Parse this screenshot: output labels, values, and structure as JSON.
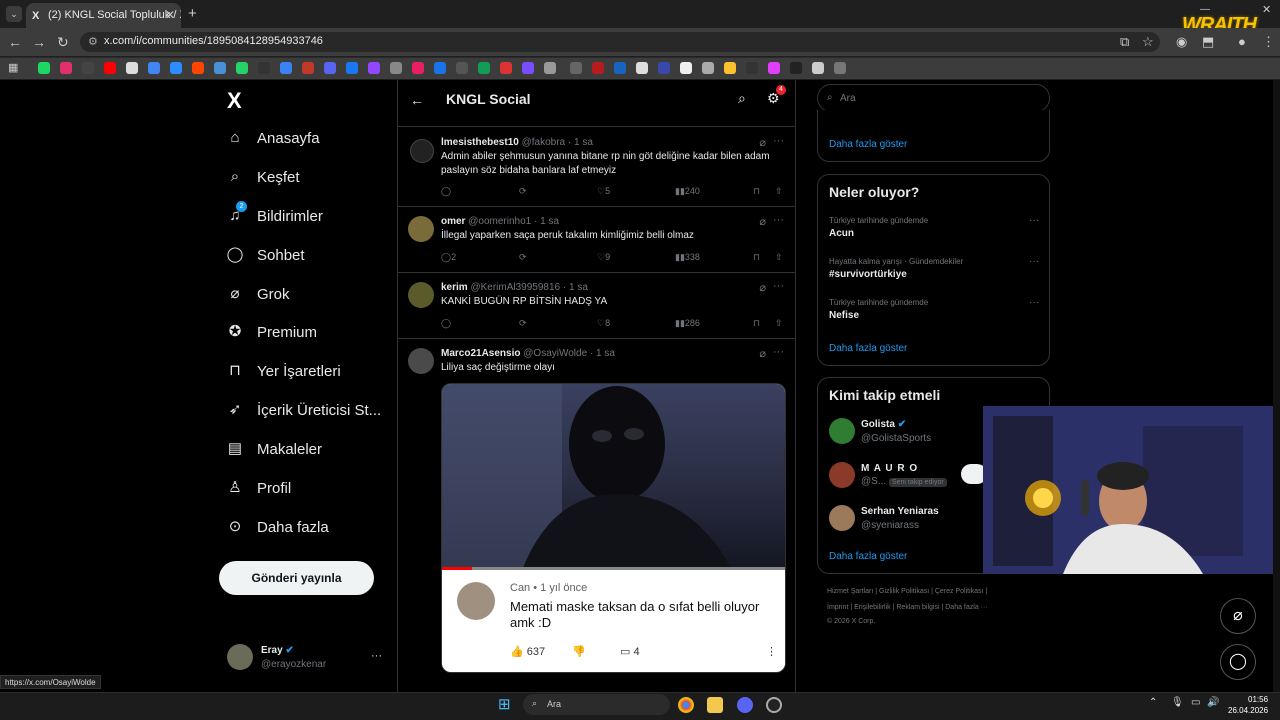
{
  "browser": {
    "tab_title": "(2) KNGL Social Topluluk / X",
    "tab_favicon": "X",
    "url": "x.com/i/communities/1895084128954933746",
    "status_url": "https://x.com/OsayiWolde",
    "overlay_logo": "WRAITH"
  },
  "left_nav": {
    "logo": "X",
    "items": [
      {
        "label": "Anasayfa",
        "icon": "home-icon"
      },
      {
        "label": "Keşfet",
        "icon": "search-icon"
      },
      {
        "label": "Bildirimler",
        "icon": "bell-icon",
        "badge": "2"
      },
      {
        "label": "Sohbet",
        "icon": "chat-icon"
      },
      {
        "label": "Grok",
        "icon": "grok-icon"
      },
      {
        "label": "Premium",
        "icon": "premium-icon"
      },
      {
        "label": "Yer İşaretleri",
        "icon": "bookmark-icon"
      },
      {
        "label": "İçerik Üreticisi St...",
        "icon": "rocket-icon"
      },
      {
        "label": "Makaleler",
        "icon": "article-icon"
      },
      {
        "label": "Profil",
        "icon": "person-icon"
      },
      {
        "label": "Daha fazla",
        "icon": "more-icon"
      }
    ],
    "post_button": "Gönderi yayınla",
    "user": {
      "name": "Eray",
      "handle": "@erayozkenar"
    }
  },
  "community": {
    "title": "KNGL Social",
    "settings_badge": "4"
  },
  "tweets": [
    {
      "name": "lmesisthebest10",
      "handle": "@fakobra",
      "time": "· 1 sa",
      "text": "Admin abiler şehmusun yanına bitane rp nin göt deliğine kadar bilen adam paslayın söz bidaha banlara laf etmeyiz",
      "replies": "",
      "likes": "5",
      "views": "240"
    },
    {
      "name": "omer",
      "handle": "@oomerinho1",
      "time": "· 1 sa",
      "text": "İllegal yaparken saça peruk takalım kimliğimiz belli olmaz",
      "replies": "2",
      "likes": "9",
      "views": "338"
    },
    {
      "name": "kerim",
      "handle": "@KerimAl39959816",
      "time": "· 1 sa",
      "text": "KANKİ BUGÜN RP BİTSİN HADŞ YA",
      "replies": "",
      "likes": "8",
      "views": "286"
    },
    {
      "name": "Marco21Asensio",
      "handle": "@OsayiWolde",
      "time": "· 1 sa",
      "text": "Liliya saç değiştirme olayı",
      "media_comment": {
        "author": "Can",
        "time": "• 1 yıl önce",
        "text": "Memati maske taksan da o sıfat belli oluyor amk :D",
        "likes": "637",
        "replies": "4"
      }
    }
  ],
  "right_col": {
    "search_placeholder": "Ara",
    "show_more_1": "Daha fazla göster",
    "trends_title": "Neler oluyor?",
    "trends": [
      {
        "meta": "Türkiye tarihinde gündemde",
        "name": "Acun"
      },
      {
        "meta": "Hayatta kalma yarışı · Gündemdekiler",
        "name": "#survivortürkiye"
      },
      {
        "meta": "Türkiye tarihinde gündemde",
        "name": "Nefise"
      }
    ],
    "show_more_2": "Daha fazla göster",
    "follow_title": "Kimi takip etmeli",
    "follow": [
      {
        "name": "Golista",
        "handle": "@GolistaSports",
        "follows_you": ""
      },
      {
        "name": "M A U R O",
        "handle": "@S...",
        "follows_you": "Seni takip ediyor"
      },
      {
        "name": "Serhan Yeniaras",
        "handle": "@syeniarass",
        "follows_you": ""
      }
    ],
    "show_more_3": "Daha fazla göster",
    "footer_line1": "Hizmet Şartları  |  Gizlilik Politikası  |  Çerez Politikası  |",
    "footer_line2": "İmprint  |  Erişilebilirlik  |  Reklam bilgisi  |  Daha fazla ···",
    "footer_line3": "© 2026 X Corp."
  },
  "taskbar": {
    "search": "Ara",
    "time": "01:56",
    "date": "26.04.2026"
  },
  "colors": {
    "accent": "#1d9bf0",
    "background": "#000000",
    "border": "#2f3336",
    "muted": "#71767b"
  }
}
